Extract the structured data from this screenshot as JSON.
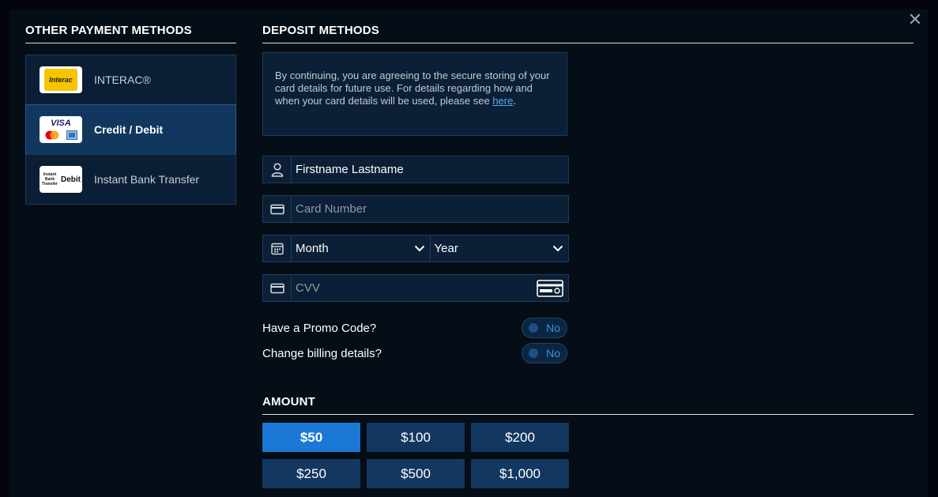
{
  "left": {
    "title": "OTHER PAYMENT METHODS",
    "methods": [
      {
        "label": "INTERAC®",
        "logo": "interac-logo",
        "logo_text": "Interac"
      },
      {
        "label": "Credit / Debit",
        "logo": "card-brands-logo",
        "logo_text": "VISA",
        "active": true
      },
      {
        "label": "Instant Bank Transfer",
        "logo": "instant-bank-transfer-logo",
        "logo_text": "Instant Bank Transfer",
        "logo_text_2": "Debit"
      }
    ]
  },
  "right": {
    "title": "DEPOSIT METHODS",
    "notice": {
      "text": "By continuing, you are agreeing to the secure storing of your card details for future use. For details regarding how and when your card details will be used, please see ",
      "link": "here",
      "end": "."
    },
    "name_field": {
      "value": "Firstname Lastname",
      "icon": "user-icon"
    },
    "card_field": {
      "placeholder": "Card Number",
      "icon": "credit-card-icon"
    },
    "expiry": {
      "icon": "calendar-icon",
      "month": "Month",
      "year": "Year"
    },
    "cvv_field": {
      "placeholder": "CVV",
      "icon": "credit-card-icon",
      "help_icon": "card-back-icon"
    },
    "promo": {
      "label": "Have a Promo Code?",
      "toggle": "No"
    },
    "billing": {
      "label": "Change billing details?",
      "toggle": "No"
    }
  },
  "amount": {
    "title": "AMOUNT",
    "options": [
      "$50",
      "$100",
      "$200",
      "$250",
      "$500",
      "$1,000"
    ],
    "selected": "$50"
  },
  "colors": {
    "accent": "#1b78d4",
    "panel": "#0b1f36",
    "link": "#5aa7ea"
  }
}
